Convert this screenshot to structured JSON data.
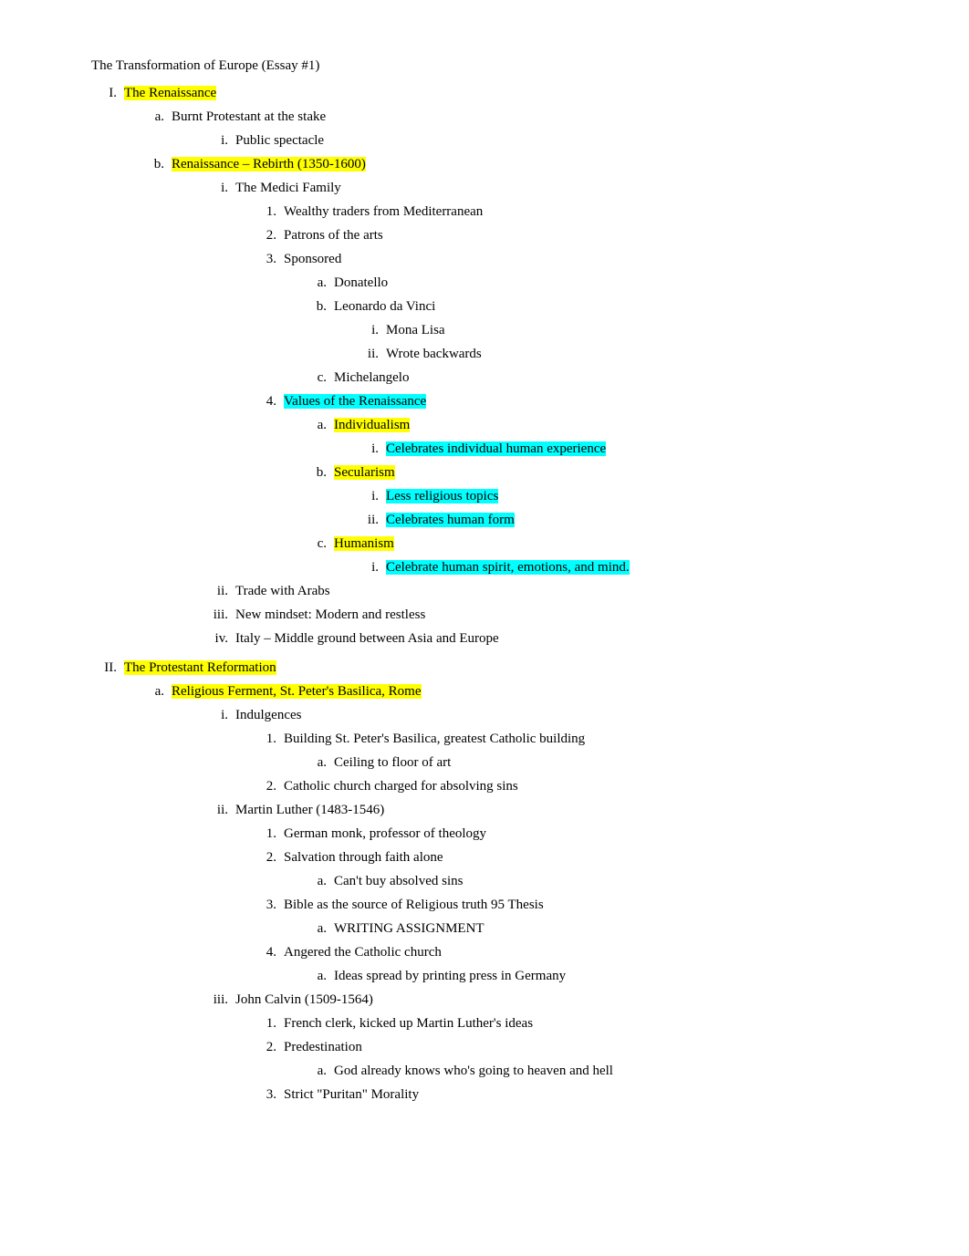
{
  "document": {
    "title": "The Transformation of Europe (Essay #1)",
    "sections": [
      {
        "numeral": "I.",
        "label": "The Renaissance",
        "highlight": "yellow",
        "children": [
          {
            "marker": "a.",
            "text": "Burnt Protestant at the stake",
            "children": [
              {
                "marker": "i.",
                "text": "Public spectacle"
              }
            ]
          },
          {
            "marker": "b.",
            "text": "Renaissance – Rebirth (1350-1600)",
            "highlight": "yellow",
            "children": [
              {
                "marker": "i.",
                "text": "The Medici Family",
                "children": [
                  {
                    "num": "1.",
                    "text": "Wealthy traders from Mediterranean"
                  },
                  {
                    "num": "2.",
                    "text": "Patrons of the arts"
                  },
                  {
                    "num": "3.",
                    "text": "Sponsored",
                    "children": [
                      {
                        "alpha": "a.",
                        "text": "Donatello"
                      },
                      {
                        "alpha": "b.",
                        "text": "Leonardo da Vinci",
                        "children": [
                          {
                            "roman": "i.",
                            "text": "Mona Lisa"
                          },
                          {
                            "roman": "ii.",
                            "text": "Wrote backwards"
                          }
                        ]
                      },
                      {
                        "alpha": "c.",
                        "text": "Michelangelo"
                      }
                    ]
                  },
                  {
                    "num": "4.",
                    "text": "Values of the Renaissance",
                    "highlight": "cyan",
                    "children": [
                      {
                        "alpha": "a.",
                        "text": "Individualism",
                        "highlight": "yellow",
                        "children": [
                          {
                            "roman": "i.",
                            "text": "Celebrates individual human experience",
                            "highlight": "cyan"
                          }
                        ]
                      },
                      {
                        "alpha": "b.",
                        "text": "Secularism",
                        "highlight": "yellow",
                        "children": [
                          {
                            "roman": "i.",
                            "text": "Less religious topics",
                            "highlight": "cyan"
                          },
                          {
                            "roman": "ii.",
                            "text": "Celebrates human form",
                            "highlight": "cyan"
                          }
                        ]
                      },
                      {
                        "alpha": "c.",
                        "text": "Humanism",
                        "highlight": "yellow",
                        "children": [
                          {
                            "roman": "i.",
                            "text": "Celebrate human spirit, emotions, and mind.",
                            "highlight": "cyan"
                          }
                        ]
                      }
                    ]
                  }
                ]
              },
              {
                "marker": "ii.",
                "text": "Trade with Arabs"
              },
              {
                "marker": "iii.",
                "text": "New mindset: Modern and restless"
              },
              {
                "marker": "iv.",
                "text": "Italy – Middle ground between Asia and Europe"
              }
            ]
          }
        ]
      },
      {
        "numeral": "II.",
        "label": "The Protestant Reformation",
        "highlight": "yellow",
        "children": [
          {
            "marker": "a.",
            "text": "Religious Ferment, St. Peter's Basilica, Rome",
            "highlight": "yellow",
            "children": [
              {
                "marker": "i.",
                "text": "Indulgences",
                "children": [
                  {
                    "num": "1.",
                    "text": "Building St. Peter's Basilica, greatest Catholic building",
                    "children": [
                      {
                        "alpha": "a.",
                        "text": "Ceiling to floor of art"
                      }
                    ]
                  },
                  {
                    "num": "2.",
                    "text": "Catholic church charged for absolving sins"
                  }
                ]
              },
              {
                "marker": "ii.",
                "text": "Martin Luther (1483-1546)",
                "children": [
                  {
                    "num": "1.",
                    "text": "German monk, professor of theology"
                  },
                  {
                    "num": "2.",
                    "text": "Salvation through faith alone",
                    "children": [
                      {
                        "alpha": "a.",
                        "text": "Can't buy absolved sins"
                      }
                    ]
                  },
                  {
                    "num": "3.",
                    "text": "Bible as the source of Religious truth    95 Thesis",
                    "children": [
                      {
                        "alpha": "a.",
                        "text": "WRITING ASSIGNMENT"
                      }
                    ]
                  },
                  {
                    "num": "4.",
                    "text": "Angered the Catholic church",
                    "children": [
                      {
                        "alpha": "a.",
                        "text": "Ideas spread by printing press in Germany"
                      }
                    ]
                  }
                ]
              },
              {
                "marker": "iii.",
                "text": "John Calvin (1509-1564)",
                "children": [
                  {
                    "num": "1.",
                    "text": "French clerk, kicked up Martin Luther's ideas"
                  },
                  {
                    "num": "2.",
                    "text": "Predestination",
                    "children": [
                      {
                        "alpha": "a.",
                        "text": "God already knows who's going to heaven and hell"
                      }
                    ]
                  },
                  {
                    "num": "3.",
                    "text": "Strict “Puritan” Morality"
                  }
                ]
              }
            ]
          }
        ]
      }
    ]
  }
}
